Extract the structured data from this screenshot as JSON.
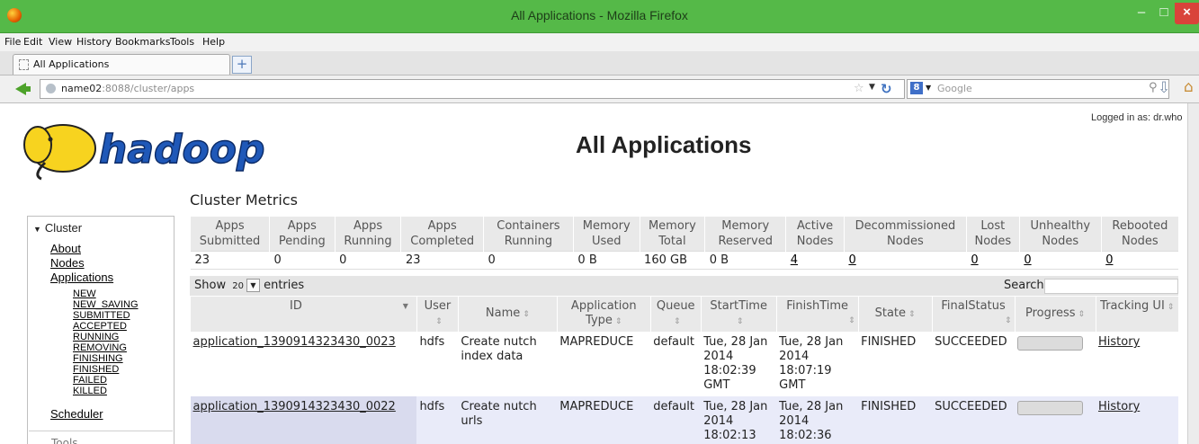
{
  "window": {
    "title": "All Applications - Mozilla Firefox",
    "minimize": "–",
    "maximize": "□",
    "close": "×"
  },
  "menu": [
    "File",
    "Edit",
    "View",
    "History",
    "Bookmarks",
    "Tools",
    "Help"
  ],
  "tab": {
    "label": "All Applications",
    "new_tab": "+"
  },
  "address": {
    "host": "name02",
    "rest": ":8088/cluster/apps"
  },
  "search_box": {
    "engine": "Google"
  },
  "header": {
    "logged_in": "Logged in as: dr.who",
    "title": "All Applications",
    "logo_text": "hadoop"
  },
  "nav": {
    "cluster_label": "Cluster",
    "links": [
      "About",
      "Nodes",
      "Applications"
    ],
    "app_states": [
      "NEW",
      "NEW_SAVING",
      "SUBMITTED",
      "ACCEPTED",
      "RUNNING",
      "REMOVING",
      "FINISHING",
      "FINISHED",
      "FAILED",
      "KILLED"
    ],
    "scheduler": "Scheduler",
    "tools_label": "Tools"
  },
  "metrics": {
    "title": "Cluster Metrics",
    "headers": [
      "Apps Submitted",
      "Apps Pending",
      "Apps Running",
      "Apps Completed",
      "Containers Running",
      "Memory Used",
      "Memory Total",
      "Memory Reserved",
      "Active Nodes",
      "Decommissioned Nodes",
      "Lost Nodes",
      "Unhealthy Nodes",
      "Rebooted Nodes"
    ],
    "values": [
      "23",
      "0",
      "0",
      "23",
      "0",
      "0 B",
      "160 GB",
      "0 B",
      "4",
      "0",
      "0",
      "0",
      "0"
    ]
  },
  "table_controls": {
    "show": "Show",
    "page_size": "20",
    "entries": "entries",
    "search": "Search:"
  },
  "apps_table": {
    "headers": [
      "ID",
      "User",
      "Name",
      "Application Type",
      "Queue",
      "StartTime",
      "FinishTime",
      "State",
      "FinalStatus",
      "Progress",
      "Tracking UI"
    ],
    "rows": [
      {
        "id": "application_1390914323430_0023",
        "user": "hdfs",
        "name": "Create nutch index data",
        "type": "MAPREDUCE",
        "queue": "default",
        "start": "Tue, 28 Jan 2014 18:02:39 GMT",
        "finish": "Tue, 28 Jan 2014 18:07:19 GMT",
        "state": "FINISHED",
        "final_status": "SUCCEEDED",
        "tracking": "History"
      },
      {
        "id": "application_1390914323430_0022",
        "user": "hdfs",
        "name": "Create nutch urls",
        "type": "MAPREDUCE",
        "queue": "default",
        "start": "Tue, 28 Jan 2014 18:02:13",
        "finish": "Tue, 28 Jan 2014 18:02:36",
        "state": "FINISHED",
        "final_status": "SUCCEEDED",
        "tracking": "History"
      }
    ]
  }
}
